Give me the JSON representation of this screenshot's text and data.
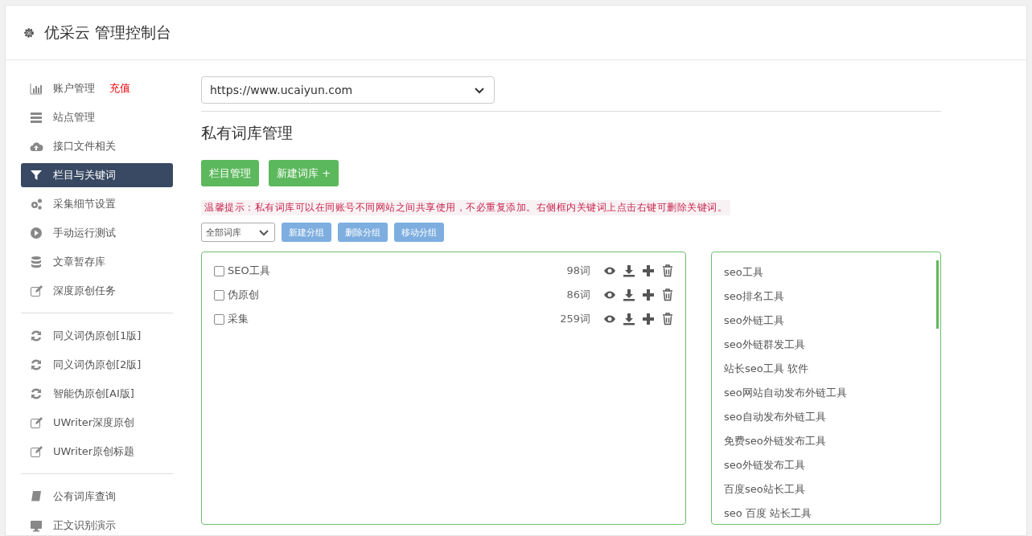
{
  "header": {
    "title": "优采云 管理控制台"
  },
  "sidebar": {
    "groups": [
      [
        {
          "kind": "chart",
          "label": "账户管理",
          "badge": "充值",
          "selected": false
        },
        {
          "kind": "server",
          "label": "站点管理",
          "selected": false
        },
        {
          "kind": "cloud",
          "label": "接口文件相关",
          "selected": false
        },
        {
          "kind": "filter",
          "label": "栏目与关键词",
          "selected": true
        },
        {
          "kind": "gears",
          "label": "采集细节设置",
          "selected": false
        },
        {
          "kind": "play",
          "label": "手动运行测试",
          "selected": false
        },
        {
          "kind": "database",
          "label": "文章暂存库",
          "selected": false
        },
        {
          "kind": "edit",
          "label": "深度原创任务",
          "selected": false
        }
      ],
      [
        {
          "kind": "refresh",
          "label": "同义词伪原创[1版]",
          "selected": false
        },
        {
          "kind": "refresh",
          "label": "同义词伪原创[2版]",
          "selected": false
        },
        {
          "kind": "refresh",
          "label": "智能伪原创[AI版]",
          "selected": false
        },
        {
          "kind": "edit",
          "label": "UWriter深度原创",
          "selected": false
        },
        {
          "kind": "edit",
          "label": "UWriter原创标题",
          "selected": false
        }
      ],
      [
        {
          "kind": "book",
          "label": "公有词库查询",
          "selected": false
        },
        {
          "kind": "monitor",
          "label": "正文识别演示",
          "selected": false
        }
      ]
    ]
  },
  "main": {
    "site_select": {
      "value": "https://www.ucaiyun.com"
    },
    "heading": "私有词库管理",
    "actions": [
      "栏目管理",
      "新建词库 +"
    ],
    "tip": "温馨提示：私有词库可以在同账号不同网站之间共享使用，不必重复添加。右侧框内关键词上点击右键可删除关键词。",
    "filter": {
      "value": "全部词库"
    },
    "group_buttons": [
      "新建分组",
      "删除分组",
      "移动分组"
    ],
    "libraries": [
      {
        "name": "SEO工具",
        "count": "98词",
        "checked": false
      },
      {
        "name": "伪原创",
        "count": "86词",
        "checked": false
      },
      {
        "name": "采集",
        "count": "259词",
        "checked": false
      }
    ],
    "keywords": [
      "seo工具",
      "seo排名工具",
      "seo外链工具",
      "seo外链群发工具",
      "站长seo工具 软件",
      "seo网站自动发布外链工具",
      "seo自动发布外链工具",
      "免费seo外链发布工具",
      "seo外链发布工具",
      "百度seo站长工具",
      "seo 百度 站长工具"
    ]
  }
}
